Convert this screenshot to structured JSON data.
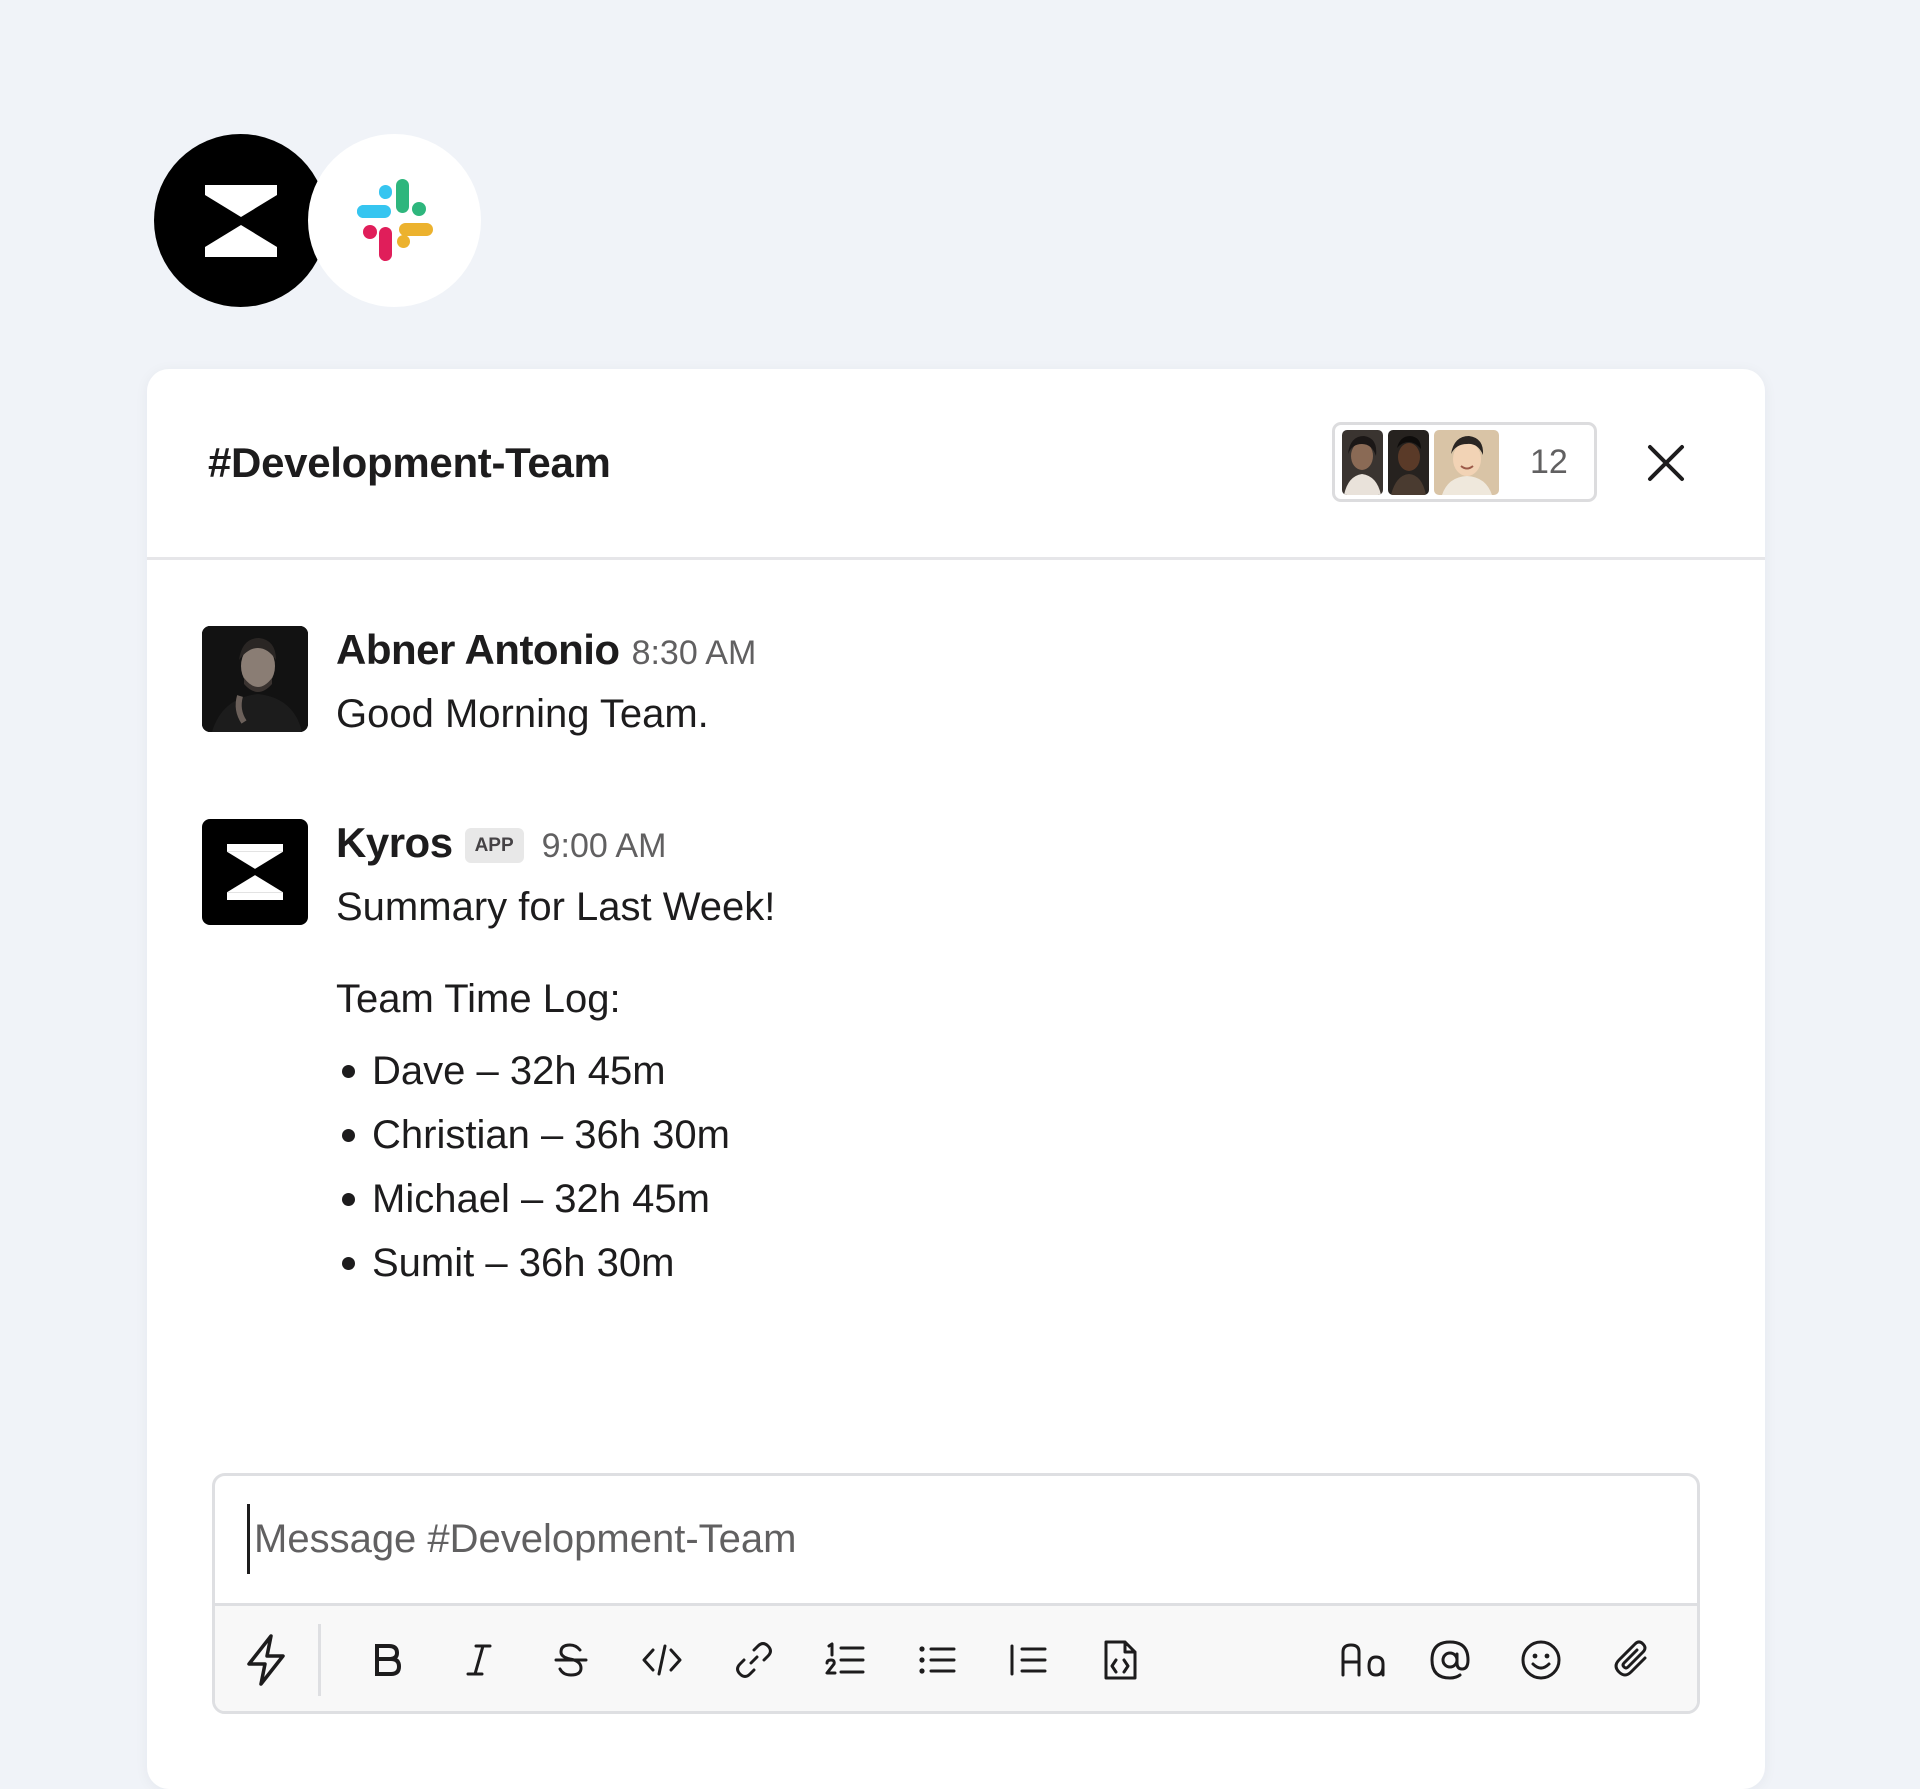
{
  "header": {
    "channel_title": "#Development-Team",
    "member_count": "12"
  },
  "messages": [
    {
      "sender": "Abner Antonio",
      "time": "8:30 AM",
      "text": "Good Morning Team."
    },
    {
      "sender": "Kyros",
      "badge": "APP",
      "time": "9:00 AM",
      "text": "Summary for Last Week!",
      "log_title": "Team Time Log:",
      "log_items": [
        "Dave – 32h 45m",
        "Christian – 36h 30m",
        "Michael – 32h 45m",
        "Sumit – 36h 30m"
      ]
    }
  ],
  "composer": {
    "placeholder": "Message #Development-Team",
    "toolbar_icons": [
      "shortcuts-icon",
      "bold-icon",
      "italic-icon",
      "strikethrough-icon",
      "code-icon",
      "link-icon",
      "ordered-list-icon",
      "bulleted-list-icon",
      "blockquote-icon",
      "code-block-icon",
      "formatting-icon",
      "mention-icon",
      "emoji-icon",
      "attachment-icon"
    ]
  },
  "colors": {
    "background": "#f0f3f8",
    "text": "#1d1c1d",
    "muted": "#616061",
    "slack_blue": "#36c5f0",
    "slack_green": "#2eb67d",
    "slack_red": "#e01e5a",
    "slack_yellow": "#ecb22e"
  }
}
